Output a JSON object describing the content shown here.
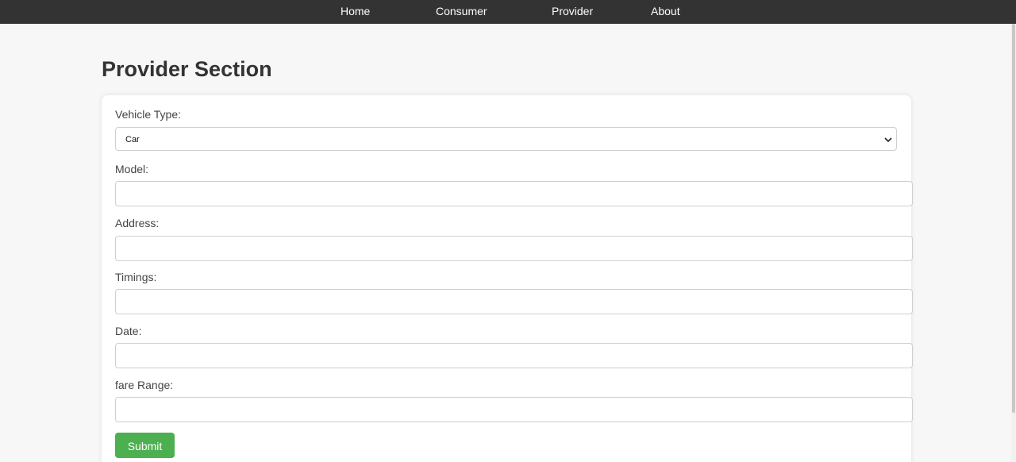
{
  "nav": {
    "home": "Home",
    "consumer": "Consumer",
    "provider": "Provider",
    "about": "About"
  },
  "page": {
    "title": "Provider Section"
  },
  "form": {
    "vehicle_type": {
      "label": "Vehicle Type:",
      "value": "Car"
    },
    "model": {
      "label": "Model:",
      "value": ""
    },
    "address": {
      "label": "Address:",
      "value": ""
    },
    "timings": {
      "label": "Timings:",
      "value": ""
    },
    "date": {
      "label": "Date:",
      "value": ""
    },
    "fare_range": {
      "label": "fare Range:",
      "value": ""
    },
    "submit_label": "Submit"
  },
  "colors": {
    "navbar": "#333333",
    "submit": "#4caf50",
    "background": "#f7f7f7"
  }
}
